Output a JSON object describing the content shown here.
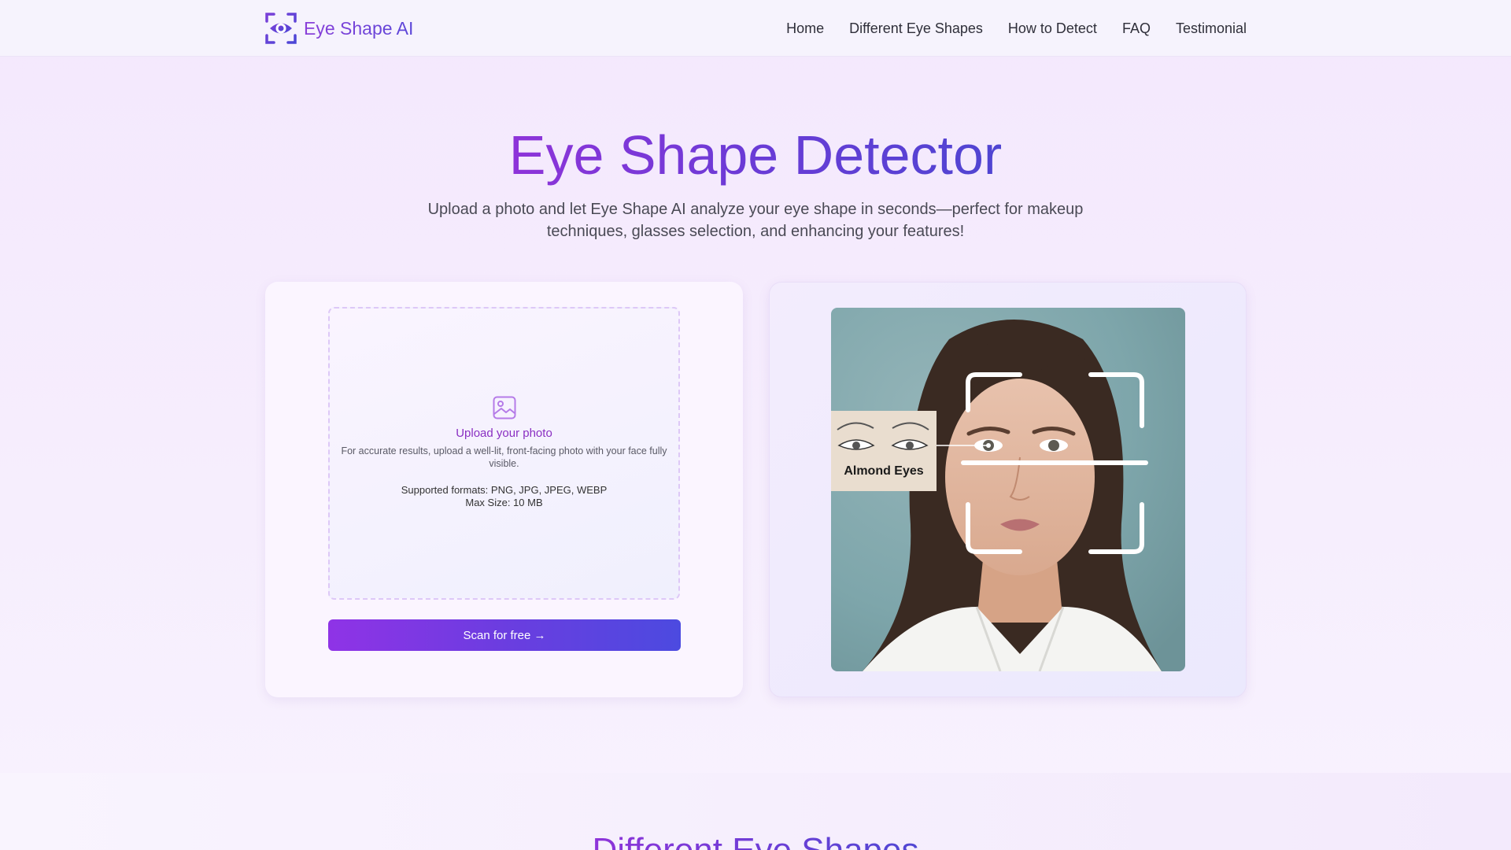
{
  "header": {
    "brand": "Eye Shape AI",
    "logo_icon": "eye-scan-icon",
    "nav": [
      "Home",
      "Different Eye Shapes",
      "How to Detect",
      "FAQ",
      "Testimonial"
    ]
  },
  "hero": {
    "title": "Eye Shape Detector",
    "subtitle": "Upload a photo and let Eye Shape AI analyze your eye shape in seconds—perfect for makeup techniques, glasses selection, and enhancing your features!"
  },
  "upload": {
    "icon": "image-icon",
    "title": "Upload your photo",
    "description": "For accurate results, upload a well-lit, front-facing photo with your face fully visible.",
    "formats": "Supported formats: PNG, JPG, JPEG, WEBP",
    "max_size": "Max Size: 10 MB",
    "button_label": "Scan for free →"
  },
  "preview": {
    "label": "Almond Eyes"
  },
  "section2": {
    "title": "Different Eye Shapes"
  },
  "colors": {
    "accent_start": "#8f33e6",
    "accent_end": "#4c4ae0",
    "upload_title": "#8a2fc2",
    "preview_background": "#7ea6ab"
  }
}
